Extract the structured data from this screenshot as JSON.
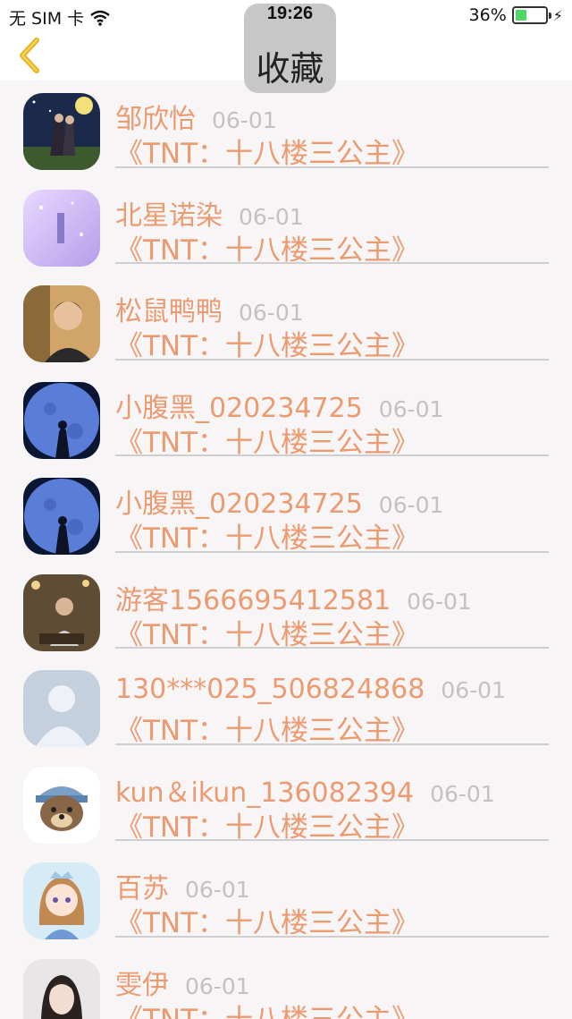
{
  "status_bar": {
    "carrier": "无 SIM 卡",
    "time": "19:26",
    "battery": "36%",
    "battery_level": 0.36,
    "icons": [
      "wifi-icon",
      "battery-icon",
      "bolt-icon"
    ]
  },
  "nav": {
    "title": "收藏",
    "back_icon": "chevron-left-icon",
    "accent": "#f1c232"
  },
  "colors": {
    "name": "#ec9b71",
    "date": "#c4c1c1",
    "background": "#f8f5f6"
  },
  "items": [
    {
      "name": "邹欣怡",
      "date": "06-01",
      "book": "《TNT：十八楼三公主》",
      "avatar": "night-couple-illustration"
    },
    {
      "name": "北星诺染",
      "date": "06-01",
      "book": "《TNT：十八楼三公主》",
      "avatar": "purple-dream-illustration"
    },
    {
      "name": "松鼠鸭鸭",
      "date": "06-01",
      "book": "《TNT：十八楼三公主》",
      "avatar": "boy-photo"
    },
    {
      "name": "小腹黑_020234725",
      "date": "06-01",
      "book": "《TNT：十八楼三公主》",
      "avatar": "moon-silhouette"
    },
    {
      "name": "小腹黑_020234725",
      "date": "06-01",
      "book": "《TNT：十八楼三公主》",
      "avatar": "moon-silhouette"
    },
    {
      "name": "游客1566695412581",
      "date": "06-01",
      "book": "《TNT：十八楼三公主》",
      "avatar": "sitting-boy-photo"
    },
    {
      "name": "130***025_506824868",
      "date": "06-01",
      "book": "《TNT：十八楼三公主》",
      "avatar": "default-user-icon"
    },
    {
      "name": "kun＆ikun_136082394",
      "date": "06-01",
      "book": "《TNT：十八楼三公主》",
      "avatar": "cartoon-bear"
    },
    {
      "name": "百苏",
      "date": "06-01",
      "book": "《TNT：十八楼三公主》",
      "avatar": "anime-girl"
    },
    {
      "name": "雯伊",
      "date": "06-01",
      "book": "《TNT：十八楼三公主》",
      "avatar": "girl-photo"
    }
  ]
}
